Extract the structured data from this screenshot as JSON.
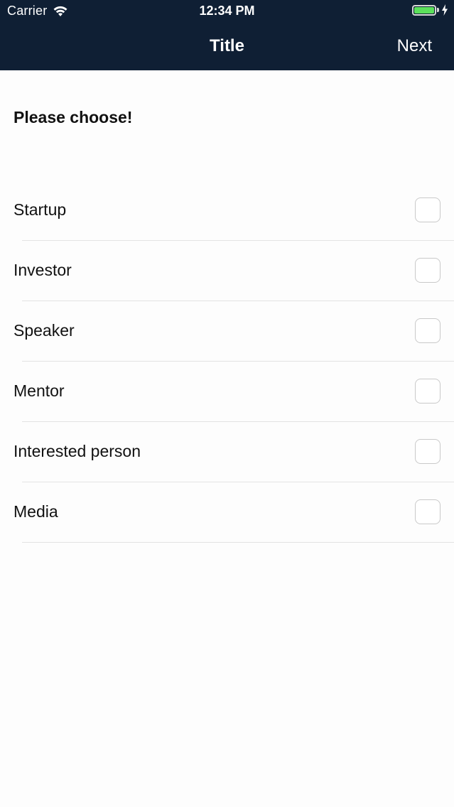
{
  "status_bar": {
    "carrier": "Carrier",
    "time": "12:34 PM",
    "battery_level": 1.0,
    "battery_color": "#5be05b",
    "icons": [
      "wifi-icon",
      "battery-icon",
      "bolt-icon"
    ]
  },
  "nav": {
    "title": "Title",
    "next_label": "Next",
    "background_color": "#0f1f34"
  },
  "content": {
    "prompt": "Please choose!",
    "options": [
      {
        "label": "Startup",
        "checked": false
      },
      {
        "label": "Investor",
        "checked": false
      },
      {
        "label": "Speaker",
        "checked": false
      },
      {
        "label": "Mentor",
        "checked": false
      },
      {
        "label": "Interested person",
        "checked": false
      },
      {
        "label": "Media",
        "checked": false
      }
    ]
  }
}
